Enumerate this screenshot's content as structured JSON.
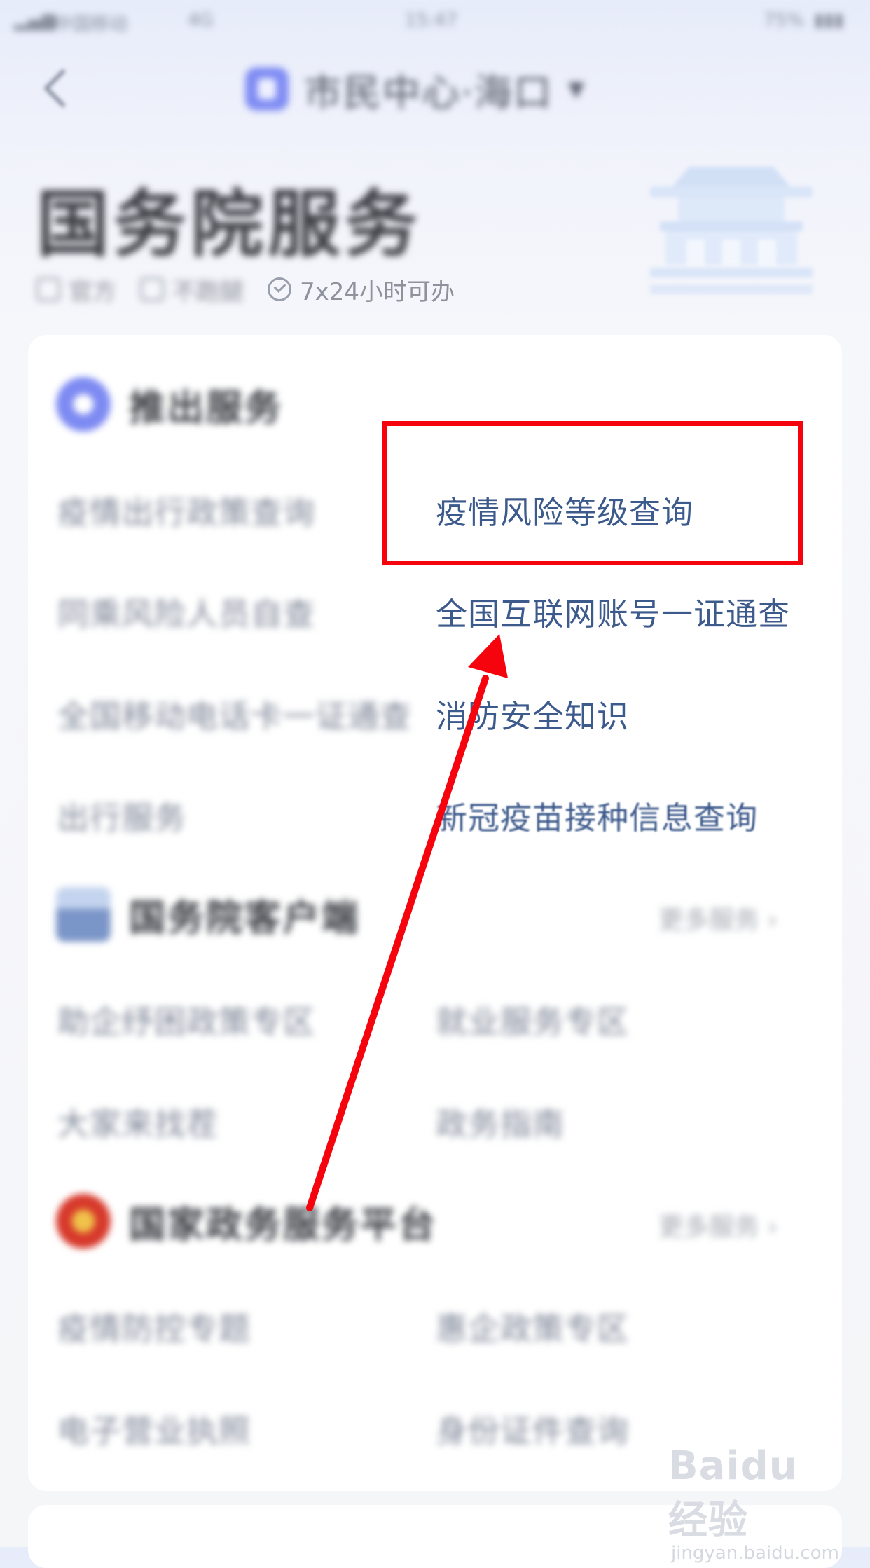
{
  "status_bar": {
    "carrier": "中国移动",
    "network": "4G",
    "time": "15:47",
    "battery": "75%"
  },
  "nav": {
    "title": "市民中心·海口",
    "caret": "▼"
  },
  "hero": {
    "title": "国务院服务",
    "tags": [
      {
        "icon": "official-icon",
        "label": "官方"
      },
      {
        "icon": "no-errand-icon",
        "label": "不跑腿"
      },
      {
        "icon": "check-circle-icon",
        "label": "7x24小时可办"
      }
    ]
  },
  "sections": [
    {
      "title": "推出服务",
      "items": [
        {
          "label": "疫情出行政策查询"
        },
        {
          "label": "疫情风险等级查询"
        },
        {
          "label": "同乘风险人员自查"
        },
        {
          "label": "全国互联网账号一证通查"
        },
        {
          "label": "全国移动电话卡一证通查"
        },
        {
          "label": "消防安全知识"
        },
        {
          "label": "出行服务"
        },
        {
          "label": "新冠疫苗接种信息查询"
        }
      ]
    },
    {
      "title": "国务院客户端",
      "more": "更多服务",
      "items": [
        {
          "label": "助企纾困政策专区"
        },
        {
          "label": "就业服务专区"
        },
        {
          "label": "大家来找茬"
        },
        {
          "label": "政务指南"
        }
      ]
    },
    {
      "title": "国家政务服务平台",
      "more": "更多服务",
      "items": [
        {
          "label": "疫情防控专题"
        },
        {
          "label": "惠企政策专区"
        },
        {
          "label": "电子营业执照"
        },
        {
          "label": "身份证件查询"
        }
      ]
    }
  ],
  "watermark": {
    "logo": "Baidu经验",
    "url": "jingyan.baidu.com"
  },
  "colors": {
    "highlight": "#f5040e",
    "link_text": "#3d5a8c",
    "brand": "#7f8cf3"
  }
}
